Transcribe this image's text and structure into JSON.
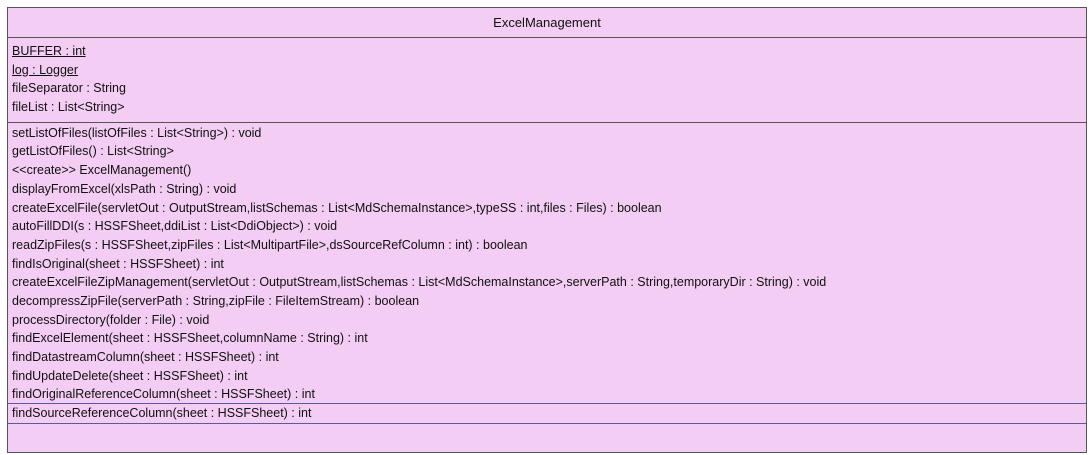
{
  "class_box": {
    "name": "ExcelManagement",
    "attributes": [
      "BUFFER : int",
      "log : Logger",
      "fileSeparator : String",
      "fileList : List<String>"
    ],
    "operations": [
      "setListOfFiles(listOfFiles : List<String>) : void",
      "getListOfFiles() : List<String>",
      "<<create>> ExcelManagement()",
      "displayFromExcel(xlsPath : String) : void",
      "createExcelFile(servletOut : OutputStream,listSchemas : List<MdSchemaInstance>,typeSS : int,files : Files) : boolean",
      "autoFillDDI(s : HSSFSheet,ddiList : List<DdiObject>) : void",
      "readZipFiles(s : HSSFSheet,zipFiles : List<MultipartFile>,dsSourceRefColumn : int) : boolean",
      "findIsOriginal(sheet : HSSFSheet) : int",
      "createExcelFileZipManagement(servletOut : OutputStream,listSchemas : List<MdSchemaInstance>,serverPath : String,temporaryDir : String) : void",
      "decompressZipFile(serverPath : String,zipFile : FileItemStream) : boolean",
      "processDirectory(folder : File) : void",
      "findExcelElement(sheet : HSSFSheet,columnName : String) : int",
      "findDatastreamColumn(sheet : HSSFSheet) : int",
      "findUpdateDelete(sheet : HSSFSheet) : int",
      "findOriginalReferenceColumn(sheet : HSSFSheet) : int",
      "findSourceReferenceColumn(sheet : HSSFSheet) : int"
    ]
  },
  "colors": {
    "class_fill": "#f3cdf3",
    "border": "#555555",
    "selection": "#5a5a9e"
  }
}
